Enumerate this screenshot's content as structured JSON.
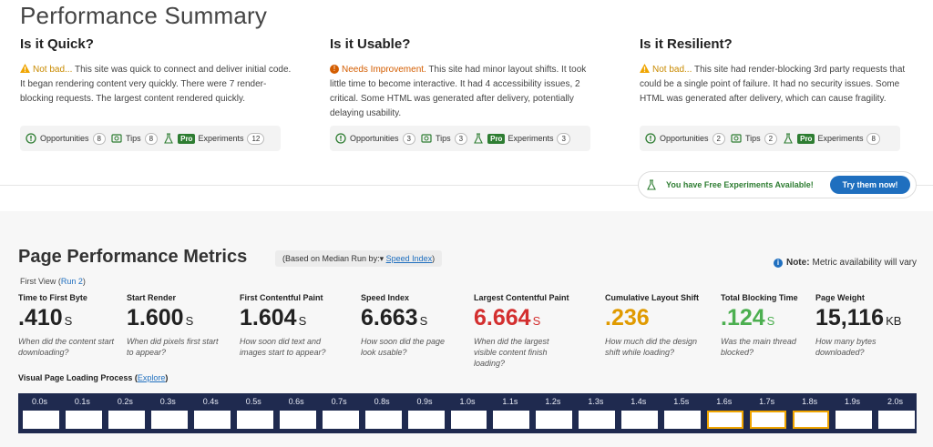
{
  "summary": {
    "title": "Performance Summary",
    "columns": [
      {
        "heading": "Is it Quick?",
        "status": "Not bad...",
        "description": " This site was quick to connect and deliver initial code. It began rendering content very quickly. There were 7 render-blocking requests. The largest content rendered quickly.",
        "opportunities_label": "Opportunities",
        "opportunities_count": "8",
        "tips_label": "Tips",
        "tips_count": "8",
        "pro_label": "Pro",
        "experiments_label": "Experiments",
        "experiments_count": "12"
      },
      {
        "heading": "Is it Usable?",
        "status": "Needs Improvement.",
        "description": " This site had minor layout shifts. It took little time to become interactive. It had 4 accessibility issues, 2 critical. Some HTML was generated after delivery, potentially delaying usability.",
        "opportunities_label": "Opportunities",
        "opportunities_count": "3",
        "tips_label": "Tips",
        "tips_count": "3",
        "pro_label": "Pro",
        "experiments_label": "Experiments",
        "experiments_count": "3"
      },
      {
        "heading": "Is it Resilient?",
        "status": "Not bad...",
        "description": " This site had render-blocking 3rd party requests that could be a single point of failure. It had no security issues. Some HTML was generated after delivery, which can cause fragility.",
        "opportunities_label": "Opportunities",
        "opportunities_count": "2",
        "tips_label": "Tips",
        "tips_count": "2",
        "pro_label": "Pro",
        "experiments_label": "Experiments",
        "experiments_count": "8"
      }
    ],
    "free_experiments_text": "You have Free Experiments Available!",
    "try_button": "Try them now!"
  },
  "metrics": {
    "title": "Page Performance Metrics",
    "median_prefix": "(Based on Median Run by:",
    "median_arrow": "▾",
    "median_metric": "Speed Index",
    "median_suffix": ")",
    "note_label": "Note:",
    "note_text": "Metric availability will vary",
    "first_view": "First View",
    "run_link": "Run 2",
    "items": [
      {
        "label": "Time to First Byte",
        "value": ".410",
        "unit": "S",
        "desc": "When did the content start downloading?"
      },
      {
        "label": "Start Render",
        "value": "1.600",
        "unit": "S",
        "desc": "When did pixels first start to appear?"
      },
      {
        "label": "First Contentful Paint",
        "value": "1.604",
        "unit": "S",
        "desc": "How soon did text and images start to appear?"
      },
      {
        "label": "Speed Index",
        "value": "6.663",
        "unit": "S",
        "desc": "How soon did the page look usable?"
      },
      {
        "label": "Largest Contentful Paint",
        "value": "6.664",
        "unit": "S",
        "desc": "When did the largest visible content finish loading?"
      },
      {
        "label": "Cumulative Layout Shift",
        "value": ".236",
        "unit": "",
        "desc": "How much did the design shift while loading?"
      },
      {
        "label": "Total Blocking Time",
        "value": ".124",
        "unit": "S",
        "desc": "Was the main thread blocked?"
      },
      {
        "label": "Page Weight",
        "value": "15,116",
        "unit": "KB",
        "desc": "How many bytes downloaded?"
      }
    ],
    "colors": {
      "bad": "#d32f2f",
      "warn": "#e09a00",
      "good": "#4caf50"
    }
  },
  "loading": {
    "title": "Visual Page Loading Process",
    "explore": "Explore",
    "frames": [
      "0.0s",
      "0.1s",
      "0.2s",
      "0.3s",
      "0.4s",
      "0.5s",
      "0.6s",
      "0.7s",
      "0.8s",
      "0.9s",
      "1.0s",
      "1.1s",
      "1.2s",
      "1.3s",
      "1.4s",
      "1.5s",
      "1.6s",
      "1.7s",
      "1.8s",
      "1.9s",
      "2.0s"
    ],
    "changed_frames": [
      "1.6s",
      "1.7s",
      "1.8s"
    ]
  },
  "icons": {
    "warning": "warning-triangle-icon",
    "needs_improvement": "alert-circle-icon",
    "opportunities": "opportunities-icon",
    "tips": "tips-icon",
    "experiments": "flask-icon",
    "info": "info-icon"
  }
}
